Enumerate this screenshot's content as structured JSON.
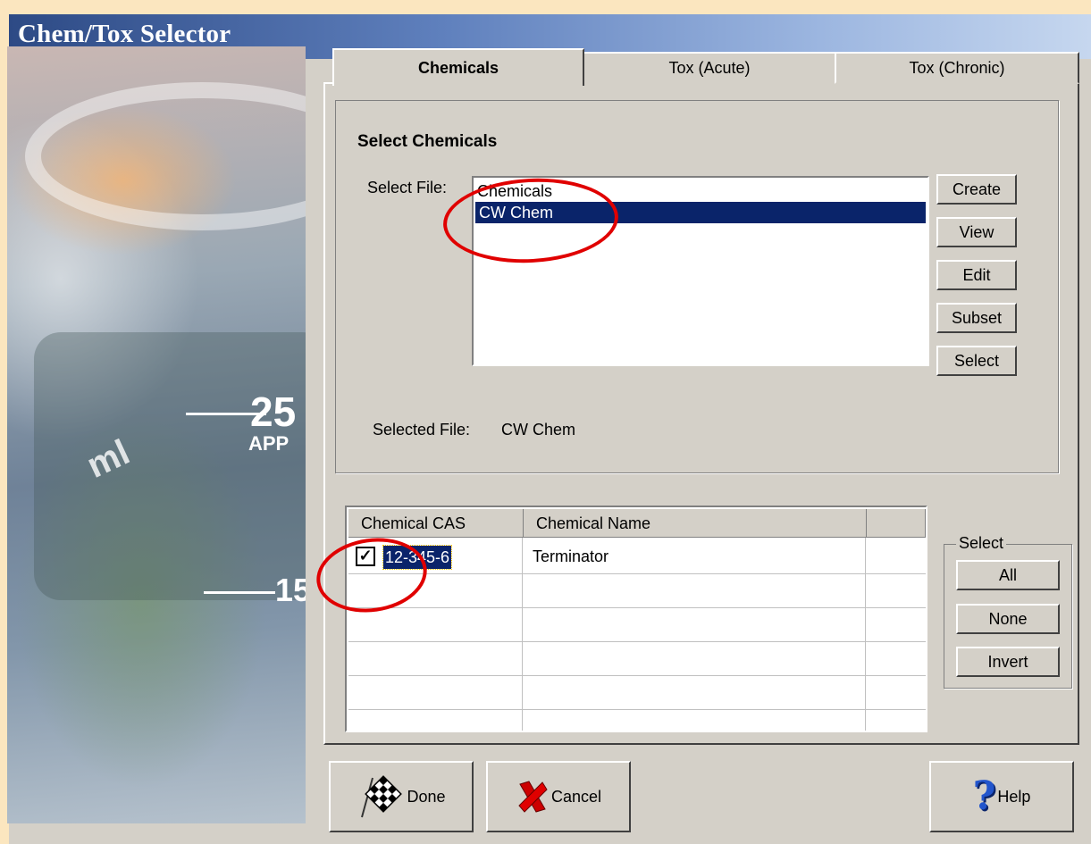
{
  "window": {
    "title": "Chem/Tox Selector"
  },
  "photo": {
    "marks": [
      "25",
      "APP",
      "15",
      "ml"
    ]
  },
  "tabs": [
    {
      "label": "Chemicals",
      "active": true
    },
    {
      "label": "Tox (Acute)",
      "active": false
    },
    {
      "label": "Tox (Chronic)",
      "active": false
    }
  ],
  "select_chemicals": {
    "heading": "Select Chemicals",
    "file_label": "Select File:",
    "files": [
      "Chemicals",
      "CW Chem"
    ],
    "selected_index": 1,
    "selected_file_label": "Selected File:",
    "selected_file_value": "CW Chem",
    "buttons": {
      "create": "Create",
      "view": "View",
      "edit": "Edit",
      "subset": "Subset",
      "select": "Select"
    }
  },
  "grid": {
    "columns": [
      "Chemical CAS",
      "Chemical Name",
      ""
    ],
    "rows": [
      {
        "checked": true,
        "cas": "12-345-6",
        "name": "Terminator"
      }
    ]
  },
  "select_group": {
    "legend": "Select",
    "buttons": {
      "all": "All",
      "none": "None",
      "invert": "Invert"
    }
  },
  "footer": {
    "done": "Done",
    "cancel": "Cancel",
    "help": "Help"
  },
  "colors": {
    "annotation": "#e00000",
    "selection": "#0a246a",
    "title_gradient_start": "#2d4a85"
  }
}
